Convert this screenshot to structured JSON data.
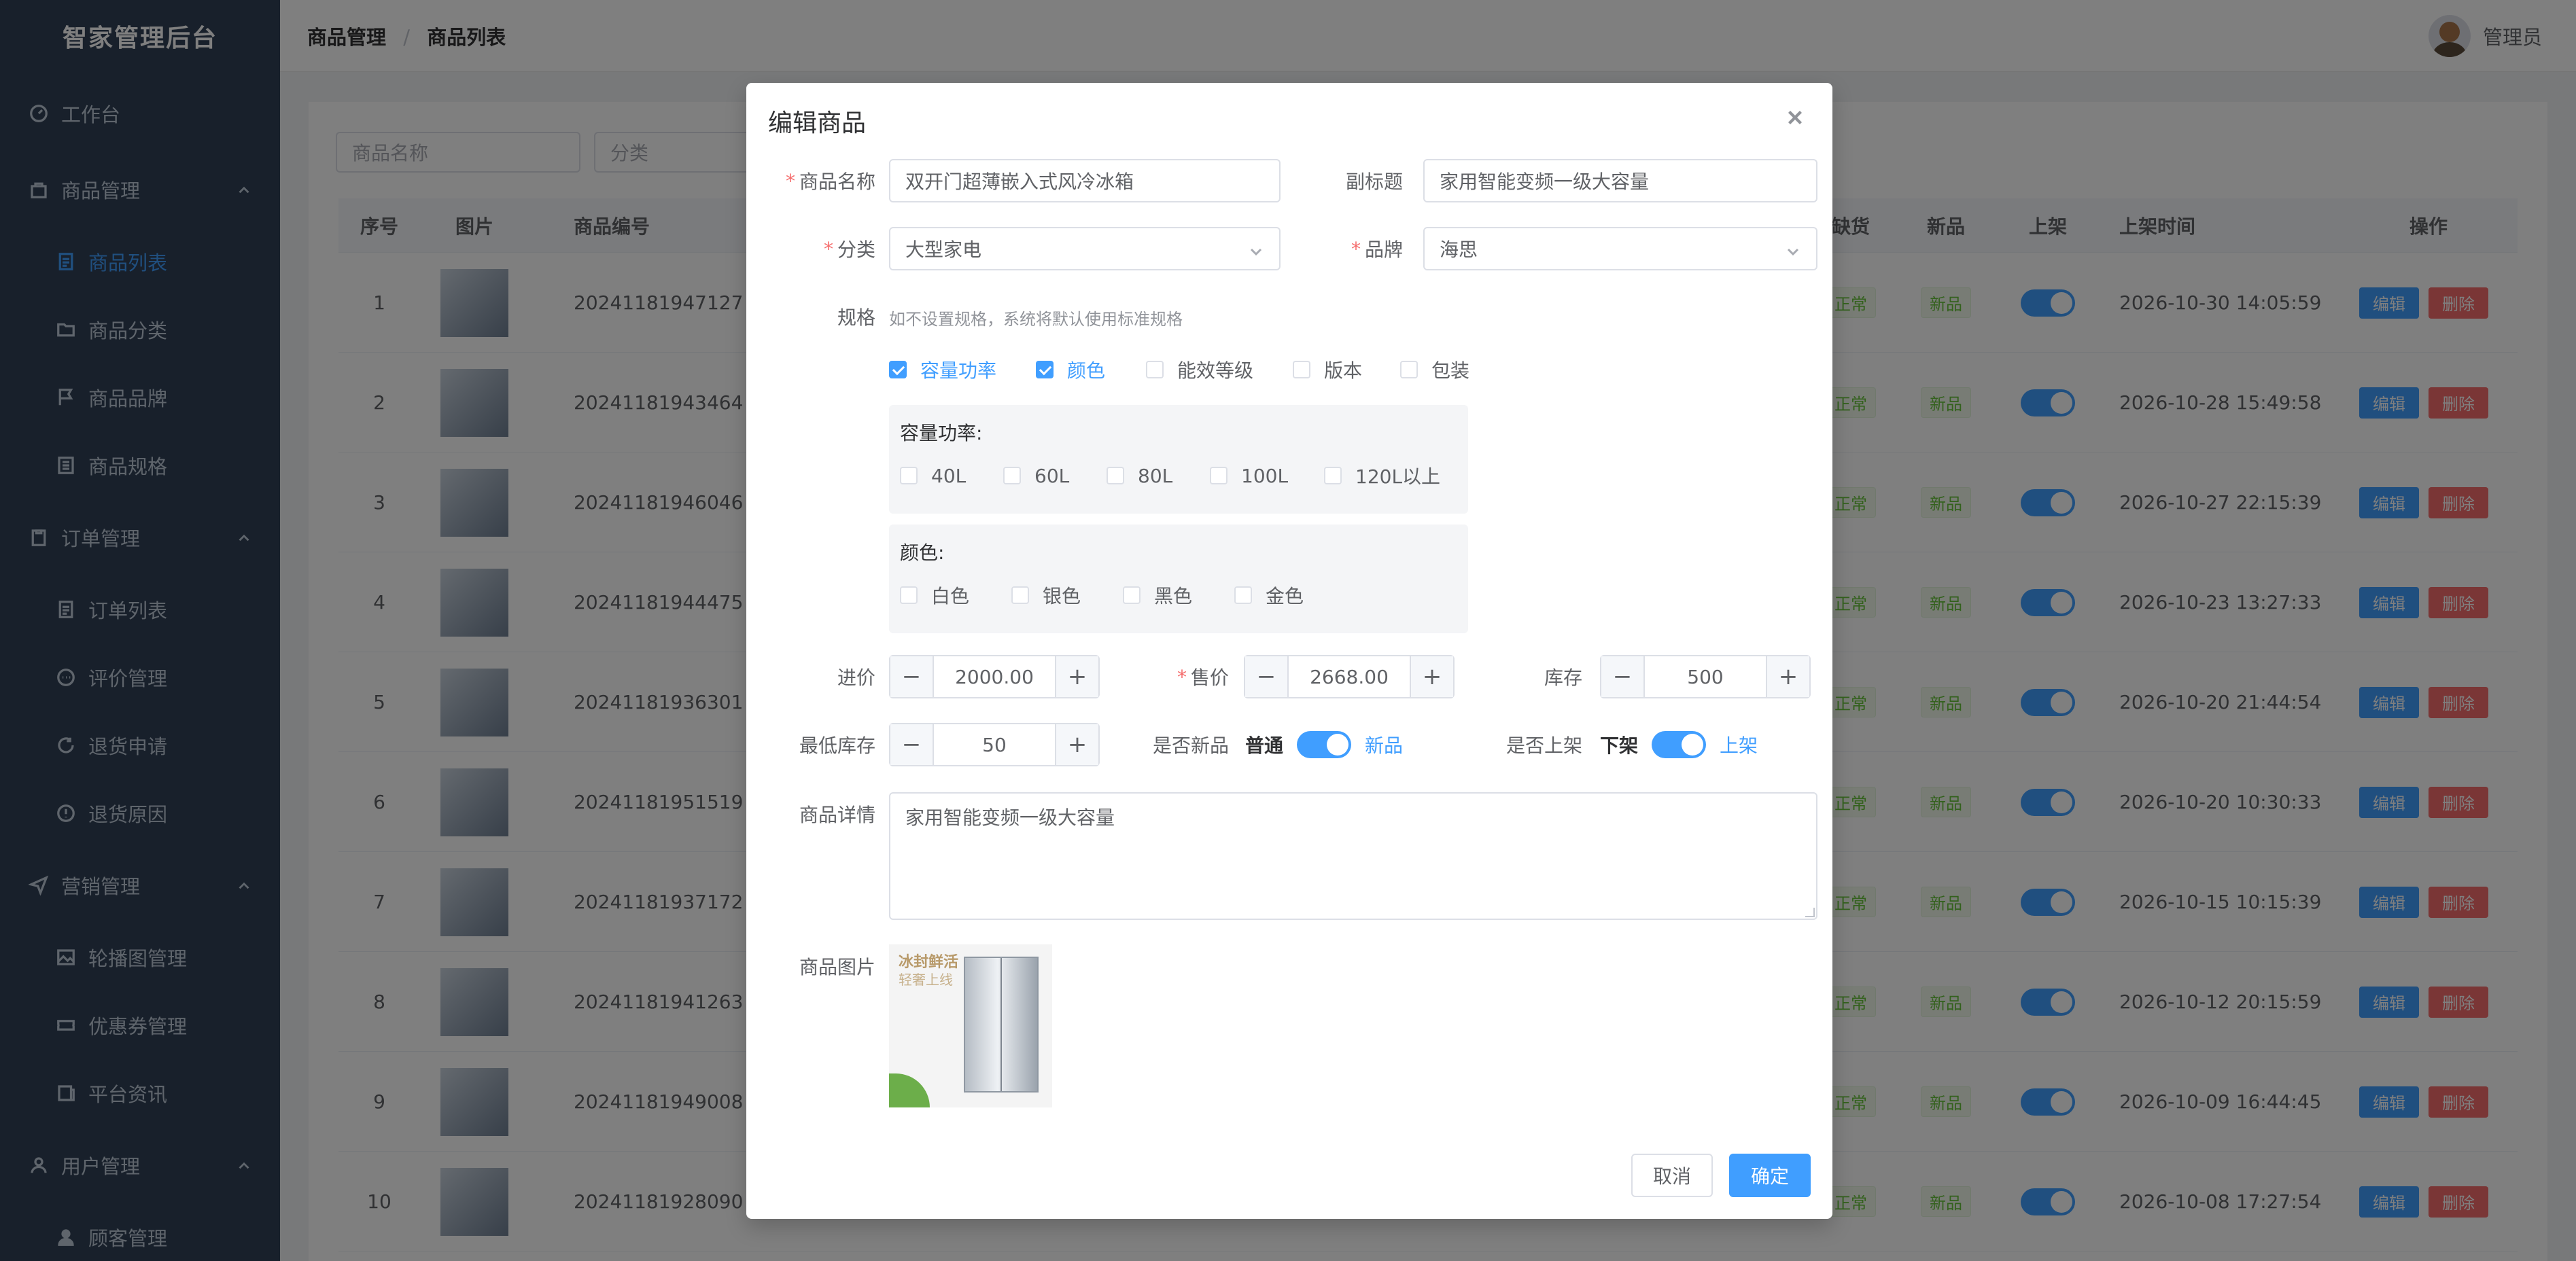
{
  "sidebar": {
    "brand": "智家管理后台",
    "items": [
      {
        "label": "工作台",
        "icon": "dashboard-icon",
        "level": "top",
        "active": false
      },
      {
        "label": "商品管理",
        "icon": "bag-icon",
        "level": "top",
        "expanded": true
      },
      {
        "label": "商品列表",
        "icon": "document-icon",
        "level": "sub",
        "active": true
      },
      {
        "label": "商品分类",
        "icon": "folder-icon",
        "level": "sub"
      },
      {
        "label": "商品品牌",
        "icon": "flag-icon",
        "level": "sub"
      },
      {
        "label": "商品规格",
        "icon": "list-icon",
        "level": "sub"
      },
      {
        "label": "订单管理",
        "icon": "clipboard-icon",
        "level": "top",
        "expanded": true
      },
      {
        "label": "订单列表",
        "icon": "document-icon",
        "level": "sub"
      },
      {
        "label": "评价管理",
        "icon": "chat-icon",
        "level": "sub"
      },
      {
        "label": "退货申请",
        "icon": "refresh-icon",
        "level": "sub"
      },
      {
        "label": "退货原因",
        "icon": "warning-icon",
        "level": "sub"
      },
      {
        "label": "营销管理",
        "icon": "send-icon",
        "level": "top",
        "expanded": true
      },
      {
        "label": "轮播图管理",
        "icon": "picture-icon",
        "level": "sub"
      },
      {
        "label": "优惠券管理",
        "icon": "ticket-icon",
        "level": "sub"
      },
      {
        "label": "平台资讯",
        "icon": "news-icon",
        "level": "sub"
      },
      {
        "label": "用户管理",
        "icon": "user-icon",
        "level": "top",
        "expanded": true
      },
      {
        "label": "顾客管理",
        "icon": "user-filled-icon",
        "level": "sub"
      }
    ]
  },
  "header": {
    "breadcrumb": [
      "商品管理",
      "商品列表"
    ],
    "user": "管理员"
  },
  "filters": {
    "name_placeholder": "商品名称",
    "category_placeholder": "分类"
  },
  "table": {
    "columns": {
      "index": "序号",
      "image": "图片",
      "code": "商品编号",
      "stockout": "缺货",
      "new": "新品",
      "onshelf": "上架",
      "time": "上架时间",
      "ops": "操作"
    },
    "rows": [
      {
        "index": "1",
        "code": "20241181947127",
        "stock": "正常",
        "new": "新品",
        "time": "2026-10-30 14:05:59"
      },
      {
        "index": "2",
        "code": "20241181943464",
        "stock": "正常",
        "new": "新品",
        "time": "2026-10-28 15:49:58"
      },
      {
        "index": "3",
        "code": "20241181946046",
        "stock": "正常",
        "new": "新品",
        "time": "2026-10-27 22:15:39"
      },
      {
        "index": "4",
        "code": "20241181944475",
        "stock": "正常",
        "new": "新品",
        "time": "2026-10-23 13:27:33"
      },
      {
        "index": "5",
        "code": "20241181936301",
        "stock": "正常",
        "new": "新品",
        "time": "2026-10-20 21:44:54"
      },
      {
        "index": "6",
        "code": "20241181951519",
        "stock": "正常",
        "new": "新品",
        "time": "2026-10-20 10:30:33"
      },
      {
        "index": "7",
        "code": "20241181937172",
        "stock": "正常",
        "new": "新品",
        "time": "2026-10-15 10:15:39"
      },
      {
        "index": "8",
        "code": "20241181941263",
        "stock": "正常",
        "new": "新品",
        "time": "2026-10-12 20:15:59"
      },
      {
        "index": "9",
        "code": "20241181949008",
        "stock": "正常",
        "new": "新品",
        "time": "2026-10-09 16:44:45"
      },
      {
        "index": "10",
        "code": "20241181928090",
        "stock": "正常",
        "new": "新品",
        "time": "2026-10-08 17:27:54"
      }
    ],
    "edit_label": "编辑",
    "delete_label": "删除"
  },
  "dialog": {
    "title": "编辑商品",
    "name_label": "商品名称",
    "name_value": "双开门超薄嵌入式风冷冰箱",
    "subtitle_label": "副标题",
    "subtitle_value": "家用智能变频一级大容量",
    "category_label": "分类",
    "category_value": "大型家电",
    "brand_label": "品牌",
    "brand_value": "海思",
    "spec_label": "规格",
    "spec_hint": "如不设置规格，系统将默认使用标准规格",
    "spec_options": [
      {
        "label": "容量功率",
        "checked": true
      },
      {
        "label": "颜色",
        "checked": true
      },
      {
        "label": "能效等级",
        "checked": false
      },
      {
        "label": "版本",
        "checked": false
      },
      {
        "label": "包装",
        "checked": false
      }
    ],
    "capacity_title": "容量功率:",
    "capacity_options": [
      "40L",
      "60L",
      "80L",
      "100L",
      "120L以上"
    ],
    "color_title": "颜色:",
    "color_options": [
      "白色",
      "银色",
      "黑色",
      "金色"
    ],
    "purchase_label": "进价",
    "purchase_value": "2000.00",
    "price_label": "售价",
    "price_value": "2668.00",
    "stock_label": "库存",
    "stock_value": "500",
    "min_stock_label": "最低库存",
    "min_stock_value": "50",
    "is_new_label": "是否新品",
    "is_new_off": "普通",
    "is_new_on": "新品",
    "is_new": true,
    "on_shelf_label": "是否上架",
    "on_shelf_off": "下架",
    "on_shelf_on": "上架",
    "on_shelf": true,
    "detail_label": "商品详情",
    "detail_value": "家用智能变频一级大容量",
    "image_label": "商品图片",
    "image_text_1": "冰封鲜活",
    "image_text_2": "轻奢上线",
    "cancel_label": "取消",
    "confirm_label": "确定"
  },
  "colors": {
    "sidebar_bg": "#304156",
    "primary": "#409eff",
    "danger": "#f56c6c",
    "success": "#67c23a"
  }
}
